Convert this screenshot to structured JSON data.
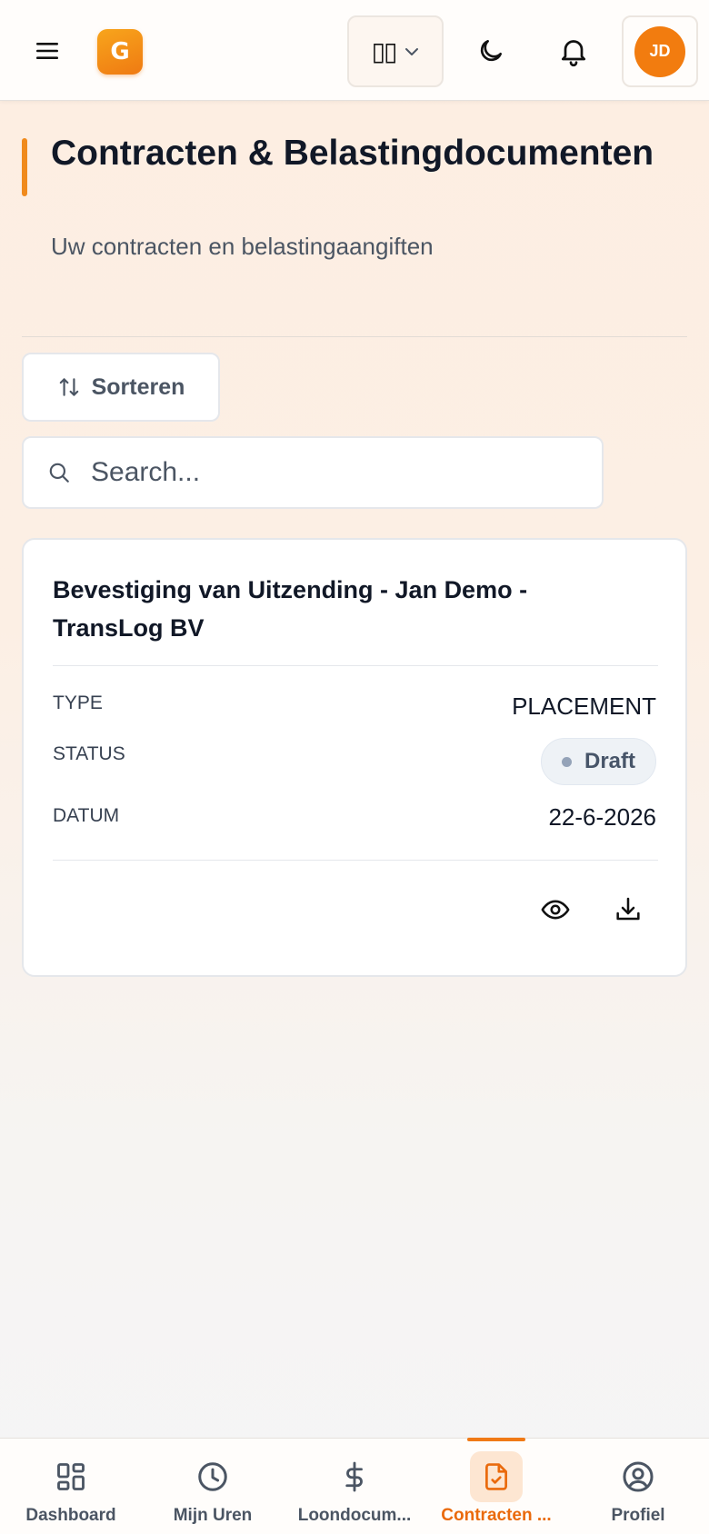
{
  "header": {
    "logo_letter": "G",
    "language_flag": "▯▯",
    "avatar_initials": "JD"
  },
  "page": {
    "title": "Contracten & Belastingdocumenten",
    "subtitle": "Uw contracten en belastingaangiften"
  },
  "toolbar": {
    "sort_label": "Sorteren",
    "search_placeholder": "Search..."
  },
  "documents": [
    {
      "title": "Bevestiging van Uitzending - Jan Demo - TransLog BV",
      "type_label": "TYPE",
      "type_value": "PLACEMENT",
      "status_label": "STATUS",
      "status_value": "Draft",
      "date_label": "DATUM",
      "date_value": "22-6-2026"
    }
  ],
  "bottom_nav": {
    "items": [
      {
        "label": "Dashboard",
        "icon": "dashboard-icon"
      },
      {
        "label": "Mijn Uren",
        "icon": "clock-icon"
      },
      {
        "label": "Loondocum...",
        "icon": "dollar-icon"
      },
      {
        "label": "Contracten ...",
        "icon": "file-check-icon",
        "active": true
      },
      {
        "label": "Profiel",
        "icon": "user-circle-icon"
      }
    ]
  },
  "colors": {
    "accent": "#f08a1c",
    "active_nav": "#ea6a0c",
    "status_draft_bg": "#eef2f6"
  }
}
